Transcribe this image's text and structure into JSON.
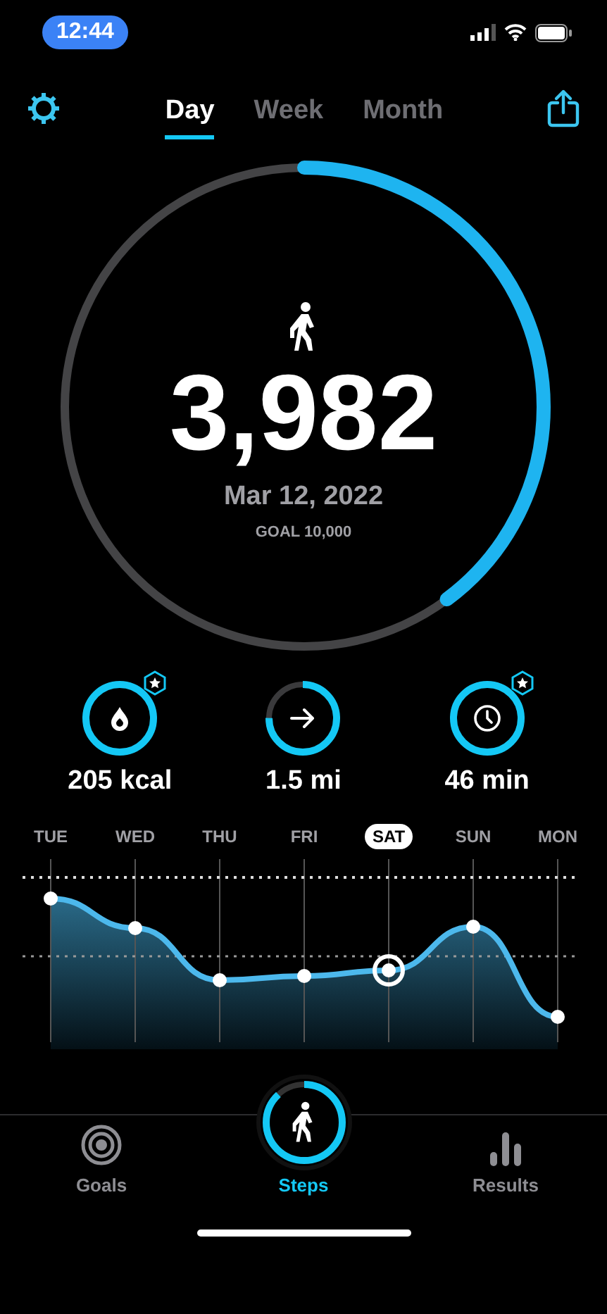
{
  "status_bar": {
    "time": "12:44"
  },
  "tabs": [
    {
      "label": "Day",
      "selected": true
    },
    {
      "label": "Week",
      "selected": false
    },
    {
      "label": "Month",
      "selected": false
    }
  ],
  "progress": {
    "level": 0.3982,
    "steps": "3,982",
    "date": "Mar 12, 2022",
    "goal": "GOAL 10,000"
  },
  "metrics": [
    {
      "kind": "energy",
      "value": "205 kcal",
      "level": 1,
      "achieved": true
    },
    {
      "kind": "distance",
      "value": "1.5 mi",
      "level": 0.75,
      "achieved": false
    },
    {
      "kind": "time",
      "value": "46 min",
      "level": 1,
      "achieved": true
    }
  ],
  "days": [
    {
      "label": "TUE",
      "selected": false
    },
    {
      "label": "WED",
      "selected": false
    },
    {
      "label": "THU",
      "selected": false
    },
    {
      "label": "FRI",
      "selected": false
    },
    {
      "label": "SAT",
      "selected": true
    },
    {
      "label": "SUN",
      "selected": false
    },
    {
      "label": "MON",
      "selected": false
    }
  ],
  "tab_bar": [
    {
      "kind": "goals",
      "label": "Goals",
      "selected": false
    },
    {
      "kind": "steps",
      "label": "Steps",
      "selected": true,
      "level": 0.88
    },
    {
      "kind": "results",
      "label": "Results",
      "selected": false
    }
  ]
}
